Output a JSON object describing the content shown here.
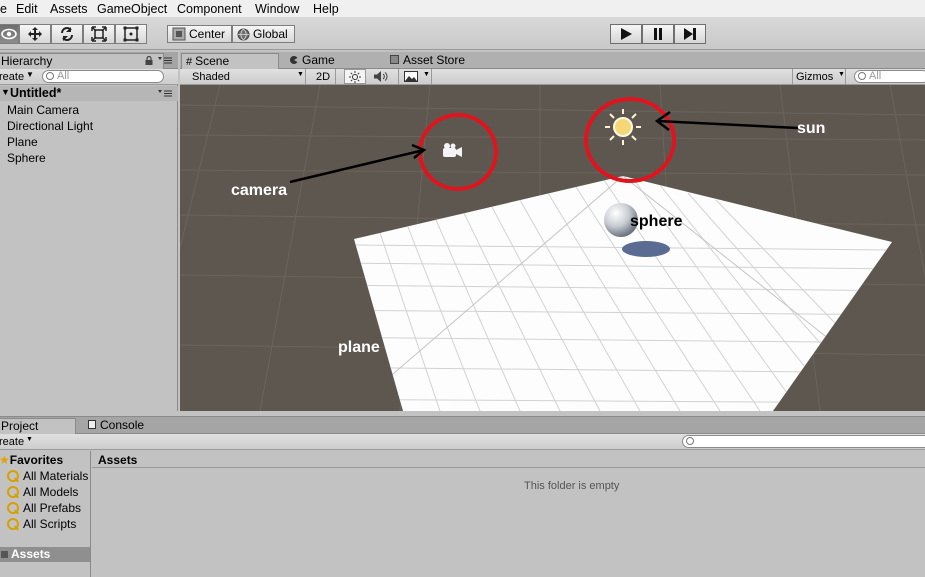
{
  "menu": [
    "e",
    "Edit",
    "Assets",
    "GameObject",
    "Component",
    "Window",
    "Help"
  ],
  "toolbar": {
    "pivot_center": "Center",
    "pivot_global": "Global"
  },
  "hierarchy": {
    "tab_label": "Hierarchy",
    "create_label": "reate",
    "search_placeholder": "All",
    "scene_name": "Untitled*",
    "items": [
      "Main Camera",
      "Directional Light",
      "Plane",
      "Sphere"
    ]
  },
  "scene": {
    "tabs": [
      "Scene",
      "Game",
      "Asset Store"
    ],
    "shading_mode": "Shaded",
    "mode_2d": "2D",
    "gizmos_label": "Gizmos",
    "search_placeholder": "All",
    "annotations": {
      "camera": "camera",
      "sun": "sun",
      "sphere": "sphere",
      "plane": "plane"
    }
  },
  "project": {
    "tabs": [
      "Project",
      "Console"
    ],
    "create_label": "reate",
    "favorites_label": "Favorites",
    "favorites": [
      "All Materials",
      "All Models",
      "All Prefabs",
      "All Scripts"
    ],
    "assets_label": "Assets",
    "breadcrumb": "Assets",
    "empty_message": "This folder is empty"
  },
  "colors": {
    "scene_bg": "#5e5750",
    "annotation_circle": "#e0141e",
    "annotation_text": "#ffffff"
  }
}
